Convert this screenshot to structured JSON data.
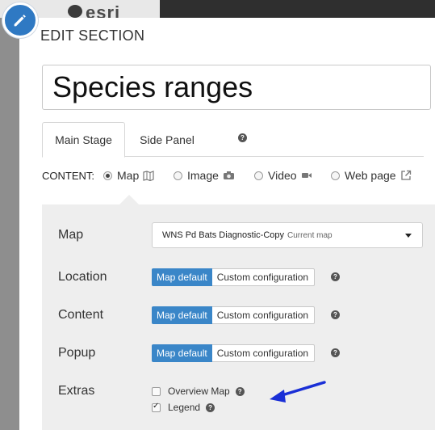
{
  "background": {
    "logo_text": "esri"
  },
  "dialog": {
    "title": "EDIT SECTION",
    "section_title_value": "Species ranges",
    "tabs": [
      {
        "label": "Main Stage",
        "active": true
      },
      {
        "label": "Side Panel",
        "active": false
      }
    ],
    "help_glyph": "?",
    "content": {
      "label": "CONTENT:",
      "options": [
        {
          "label": "Map",
          "icon": "map-icon",
          "selected": true
        },
        {
          "label": "Image",
          "icon": "camera-icon",
          "selected": false
        },
        {
          "label": "Video",
          "icon": "video-camera-icon",
          "selected": false
        },
        {
          "label": "Web page",
          "icon": "external-link-icon",
          "selected": false
        }
      ]
    },
    "panel": {
      "map": {
        "label": "Map",
        "selected_value": "WNS Pd Bats Diagnostic-Copy",
        "selected_note": "Current map"
      },
      "location": {
        "label": "Location",
        "on_label": "Map default",
        "off_label": "Custom configuration"
      },
      "content": {
        "label": "Content",
        "on_label": "Map default",
        "off_label": "Custom configuration"
      },
      "popup": {
        "label": "Popup",
        "on_label": "Map default",
        "off_label": "Custom configuration"
      },
      "extras": {
        "label": "Extras",
        "items": [
          {
            "label": "Overview Map",
            "checked": false
          },
          {
            "label": "Legend",
            "checked": true
          }
        ]
      }
    }
  },
  "colors": {
    "accent": "#3a86c8",
    "badge": "#2f79c3",
    "annotation_arrow": "#1a2fd6",
    "panel_bg": "#eeeeee"
  }
}
